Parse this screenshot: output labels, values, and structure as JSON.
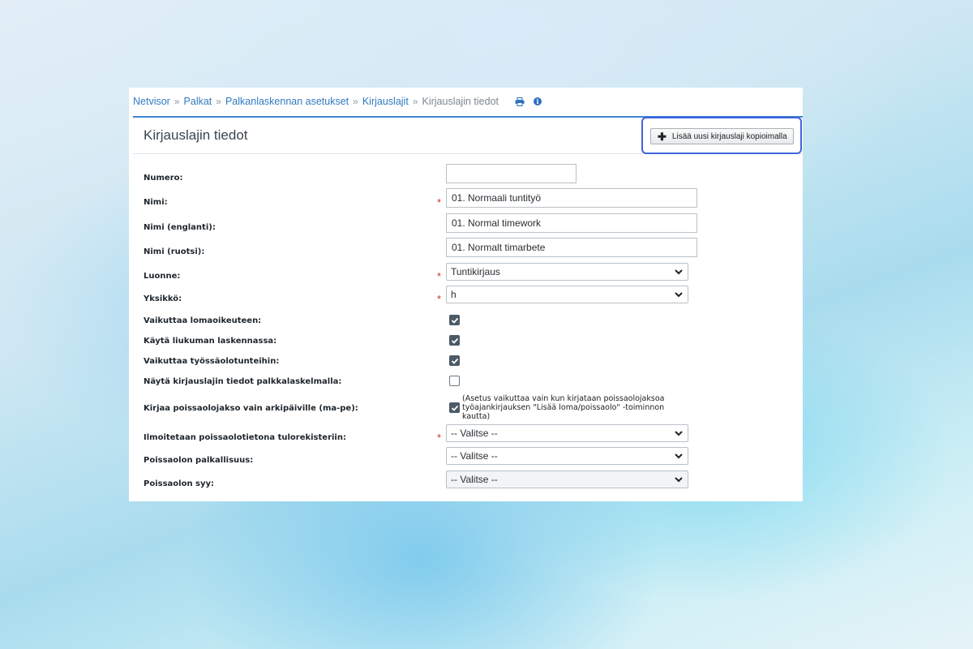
{
  "breadcrumb": {
    "items": [
      "Netvisor",
      "Palkat",
      "Palkanlaskennan asetukset",
      "Kirjauslajit"
    ],
    "separator": "»",
    "current": "Kirjauslajin tiedot",
    "icons": [
      "print-icon",
      "info-icon"
    ]
  },
  "panel": {
    "title": "Kirjauslajin tiedot",
    "add_button_label": "Lisää uusi kirjauslaji kopioimalla"
  },
  "form": {
    "required_mark": "*",
    "numero": {
      "label": "Numero:",
      "value": ""
    },
    "nimi": {
      "label": "Nimi:",
      "value": "01. Normaali tuntityö"
    },
    "nimi_en": {
      "label": "Nimi (englanti):",
      "value": "01. Normal timework"
    },
    "nimi_sv": {
      "label": "Nimi (ruotsi):",
      "value": "01. Normalt timarbete"
    },
    "luonne": {
      "label": "Luonne:",
      "value": "Tuntikirjaus"
    },
    "yksikko": {
      "label": "Yksikkö:",
      "value": "h"
    },
    "lomaoikeus": {
      "label": "Vaikuttaa lomaoikeuteen:",
      "checked": true
    },
    "liukuma": {
      "label": "Käytä liukuman laskennassa:",
      "checked": true
    },
    "tyossaolo": {
      "label": "Vaikuttaa työssäolotunteihin:",
      "checked": true
    },
    "nayta": {
      "label": "Näytä kirjauslajin tiedot palkkalaskelmalla:",
      "checked": false
    },
    "poissaolojakso": {
      "label": "Kirjaa poissaolojakso vain arkipäiville (ma-pe):",
      "checked": true,
      "note": "(Asetus vaikuttaa vain kun kirjataan poissaolojaksoa työajankirjauksen \"Lisää loma/poissaolo\" -toiminnon kautta)"
    },
    "tulorekisteri": {
      "label": "Ilmoitetaan poissaolotietona tulorekisteriin:",
      "value": "-- Valitse --"
    },
    "palkallisuus": {
      "label": "Poissaolon palkallisuus:",
      "value": "-- Valitse --"
    },
    "syy": {
      "label": "Poissaolon syy:",
      "value": "-- Valitse --"
    }
  },
  "colors": {
    "link": "#2f7ac0",
    "required": "#d32f2f",
    "header_border": "#3f86cf",
    "highlight": "#4163dc"
  }
}
